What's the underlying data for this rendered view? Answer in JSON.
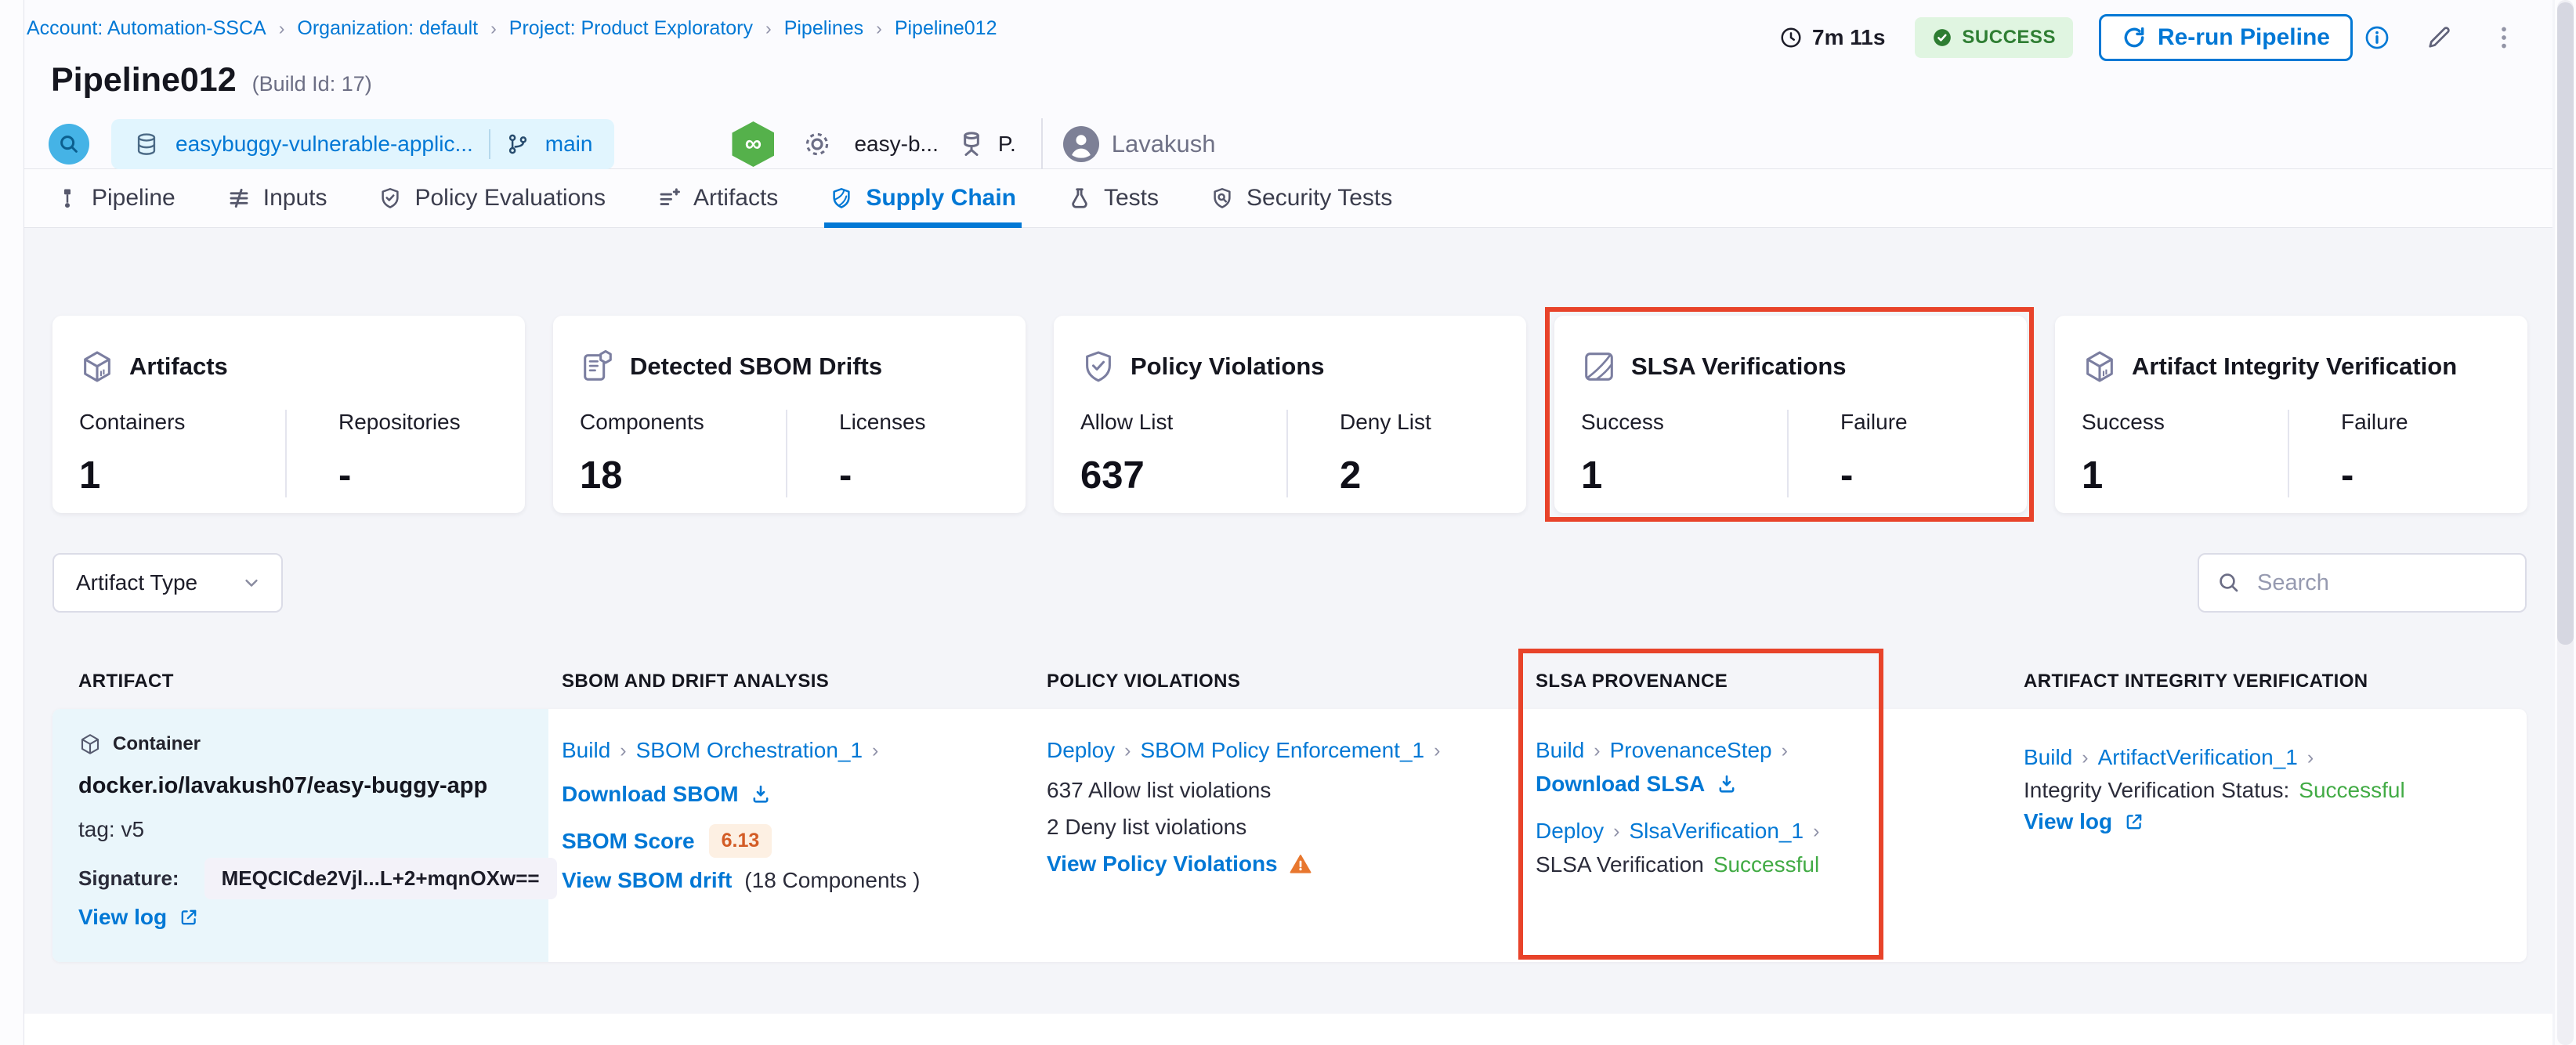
{
  "breadcrumb": {
    "items": [
      {
        "label": "Account: Automation-SSCA"
      },
      {
        "label": "Organization: default"
      },
      {
        "label": "Project: Product Exploratory"
      },
      {
        "label": "Pipelines"
      },
      {
        "label": "Pipeline012"
      }
    ]
  },
  "header": {
    "duration": "7m 11s",
    "status_badge": "SUCCESS",
    "rerun_button": "Re-run Pipeline",
    "title": "Pipeline012",
    "build_id": "(Build Id: 17)",
    "repo_name": "easybuggy-vulnerable-applic...",
    "branch_name": "main",
    "trigger_name": "easy-b...",
    "trigger_short": "P.",
    "user_name": "Lavakush"
  },
  "tabs": {
    "active": "Supply Chain",
    "items": [
      {
        "label": "Pipeline"
      },
      {
        "label": "Inputs"
      },
      {
        "label": "Policy Evaluations"
      },
      {
        "label": "Artifacts"
      },
      {
        "label": "Supply Chain"
      },
      {
        "label": "Tests"
      },
      {
        "label": "Security Tests"
      }
    ]
  },
  "summary_cards": {
    "artifacts": {
      "title": "Artifacts",
      "stat1_label": "Containers",
      "stat1_value": "1",
      "stat2_label": "Repositories",
      "stat2_value": "-"
    },
    "sbom_drifts": {
      "title": "Detected SBOM Drifts",
      "stat1_label": "Components",
      "stat1_value": "18",
      "stat2_label": "Licenses",
      "stat2_value": "-"
    },
    "policy_violations": {
      "title": "Policy Violations",
      "stat1_label": "Allow List",
      "stat1_value": "637",
      "stat2_label": "Deny List",
      "stat2_value": "2"
    },
    "slsa_verifications": {
      "title": "SLSA Verifications",
      "stat1_label": "Success",
      "stat1_value": "1",
      "stat2_label": "Failure",
      "stat2_value": "-",
      "highlighted": true
    },
    "artifact_integrity": {
      "title": "Artifact Integrity Verification",
      "stat1_label": "Success",
      "stat1_value": "1",
      "stat2_label": "Failure",
      "stat2_value": "-"
    }
  },
  "filters": {
    "artifact_type": "Artifact Type",
    "search_placeholder": "Search"
  },
  "table": {
    "headers": {
      "artifact": "ARTIFACT",
      "sbom": "SBOM AND DRIFT ANALYSIS",
      "policy": "POLICY VIOLATIONS",
      "slsa": "SLSA PROVENANCE",
      "integrity": "ARTIFACT INTEGRITY VERIFICATION"
    },
    "row": {
      "artifact": {
        "type": "Container",
        "image": "docker.io/lavakush07/easy-buggy-app",
        "tag": "tag: v5",
        "signature_label": "Signature:",
        "signature_value": "MEQCICde2Vjl...L+2+mqnOXw==",
        "view_log": "View log"
      },
      "sbom": {
        "stage": "Build",
        "step": "SBOM Orchestration_1",
        "download": "Download SBOM",
        "score_label": "SBOM Score",
        "score_value": "6.13",
        "drift_link": "View SBOM drift",
        "components": "(18 Components )"
      },
      "policy": {
        "stage": "Deploy",
        "step": "SBOM Policy Enforcement_1",
        "allow": "637 Allow list violations",
        "deny": "2 Deny list violations",
        "view": "View Policy Violations"
      },
      "slsa": {
        "stage1": "Build",
        "step1": "ProvenanceStep",
        "download": "Download SLSA",
        "stage2": "Deploy",
        "step2": "SlsaVerification_1",
        "status_label": "SLSA Verification",
        "status_value": "Successful"
      },
      "integrity": {
        "stage": "Build",
        "step": "ArtifactVerification_1",
        "status_label": "Integrity Verification Status:",
        "status_value": "Successful",
        "view_log": "View log"
      }
    }
  },
  "colors": {
    "accent_blue": "#0278d5",
    "success_green": "#42ab45",
    "success_badge_bg": "#e0f5e1",
    "success_badge_text": "#2f7e33",
    "highlight_red": "#e8432a",
    "warning_orange": "#e8772e",
    "score_orange": "#d35c26",
    "artifact_cell_bg": "#eaf6fb",
    "page_bg": "#f4f5f9"
  }
}
